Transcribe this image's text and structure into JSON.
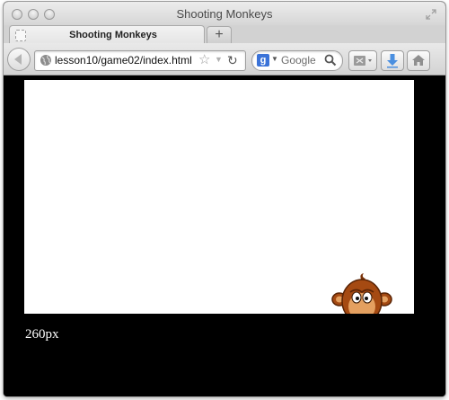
{
  "window": {
    "title": "Shooting Monkeys"
  },
  "tabs": [
    {
      "label": "Shooting Monkeys",
      "active": true
    }
  ],
  "toolbar": {
    "new_tab_symbol": "+",
    "url": "lesson10/game02/index.html",
    "search_placeholder": "Google",
    "search_engine_icon_letter": "g",
    "star_symbol": "☆",
    "history_symbol": "▼",
    "reload_symbol": "↻"
  },
  "icons": {
    "back": "back-arrow-icon",
    "globe": "globe-icon",
    "bookmark": "star-icon",
    "reload": "reload-icon",
    "search_engine": "google-icon",
    "search": "magnifier-icon",
    "screenshot": "screenshot-icon",
    "download": "download-arrow-icon",
    "home": "home-icon",
    "fullscreen": "resize-icon"
  },
  "game": {
    "sprite": "monkey",
    "height_readout": "260px"
  },
  "colors": {
    "page_background": "#000000",
    "canvas_background": "#ffffff",
    "monkey_fur": "#a54a12",
    "download_accent": "#4a8fe0",
    "search_engine_accent": "#3b73d8"
  }
}
